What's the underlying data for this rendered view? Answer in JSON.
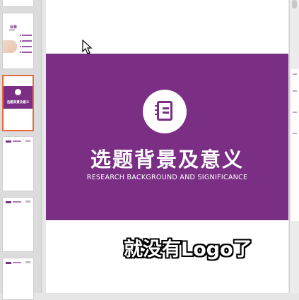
{
  "thumbnails": {
    "toc": {
      "title": "目录"
    },
    "current": {
      "title": "选题背景及意义"
    }
  },
  "slide": {
    "title_cn": "选题背景及意义",
    "title_en": "RESEARCH BACKGROUND AND SIGNIFICANCE",
    "icon": "notebook-icon",
    "band_color": "#7a2e84"
  },
  "caption": "就没有Logo了",
  "colors": {
    "accent": "#7a2e84",
    "selection": "#e8693a"
  }
}
